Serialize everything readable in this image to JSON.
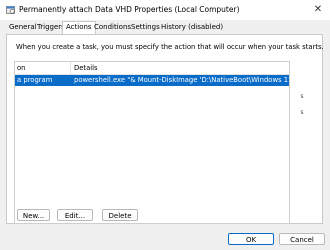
{
  "window": {
    "title": "Permanently attach Data VHD Properties (Local Computer)",
    "close_glyph": "✕"
  },
  "tabs": [
    {
      "label": "General"
    },
    {
      "label": "Triggers"
    },
    {
      "label": "Actions"
    },
    {
      "label": "Conditions"
    },
    {
      "label": "Settings"
    },
    {
      "label": "History (disabled)"
    }
  ],
  "actions": {
    "info_text": "When you create a task, you must specify the action that will occur when your task starts.",
    "columns": {
      "action": "on",
      "details": "Details"
    },
    "rows": [
      {
        "action": "a program",
        "details": "powershell.exe \"& Mount-DiskImage 'D:\\NativeBoot\\Windows 11 Data.vhdx'\""
      }
    ],
    "side_up": "s",
    "side_down": "s",
    "new_label": "New...",
    "edit_label": "Edit...",
    "delete_label": "Delete"
  },
  "footer": {
    "ok_label": "OK",
    "cancel_label": "Cancel"
  },
  "colors": {
    "accent": "#0a6cc9"
  },
  "icons": {
    "app": "task-icon"
  }
}
